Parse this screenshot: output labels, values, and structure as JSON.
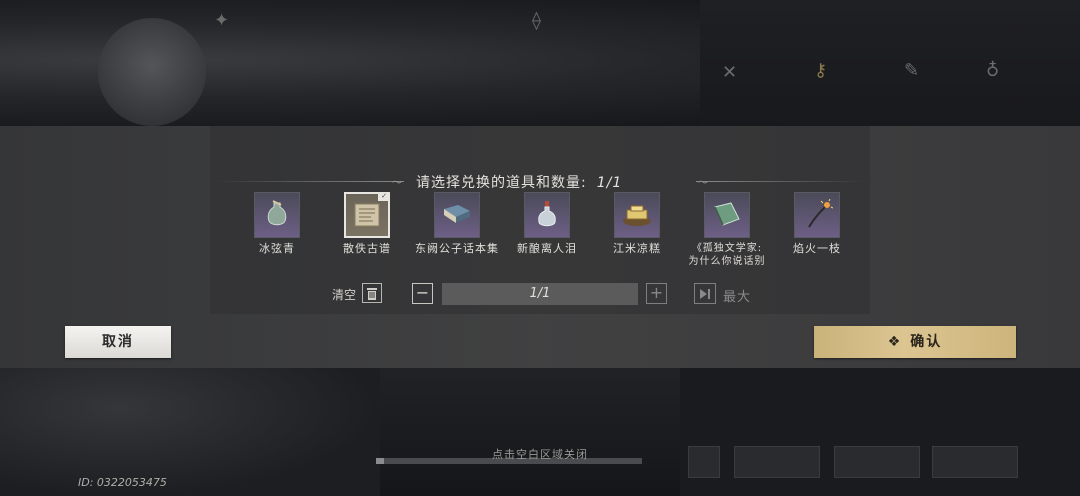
{
  "dialog": {
    "title": "请选择兑换的道具和数量:",
    "title_count": "1/1",
    "items": [
      {
        "name": "冰弦青",
        "icon": "vase-icon",
        "selected": false
      },
      {
        "name": "散佚古谱",
        "icon": "scroll-icon",
        "selected": true
      },
      {
        "name": "东阙公子话本集",
        "icon": "book-icon",
        "selected": false
      },
      {
        "name": "新酿离人泪",
        "icon": "bottle-icon",
        "selected": false
      },
      {
        "name": "江米凉糕",
        "icon": "cake-icon",
        "selected": false
      },
      {
        "name": "《孤独文学家:\n为什么你说话别",
        "icon": "book-green-icon",
        "selected": false
      },
      {
        "name": "焰火一枝",
        "icon": "firework-icon",
        "selected": false
      }
    ],
    "clear_label": "清空",
    "quantity": "1/1",
    "max_label": "最大",
    "cancel_label": "取消",
    "confirm_label": "确认"
  },
  "footer": {
    "close_hint": "点击空白区域关闭",
    "uid": "ID: 0322053475"
  },
  "colors": {
    "confirm_gold": "#d6bf89",
    "cancel_white": "#eeede9",
    "item_tile_purple": "#6d5f86"
  }
}
